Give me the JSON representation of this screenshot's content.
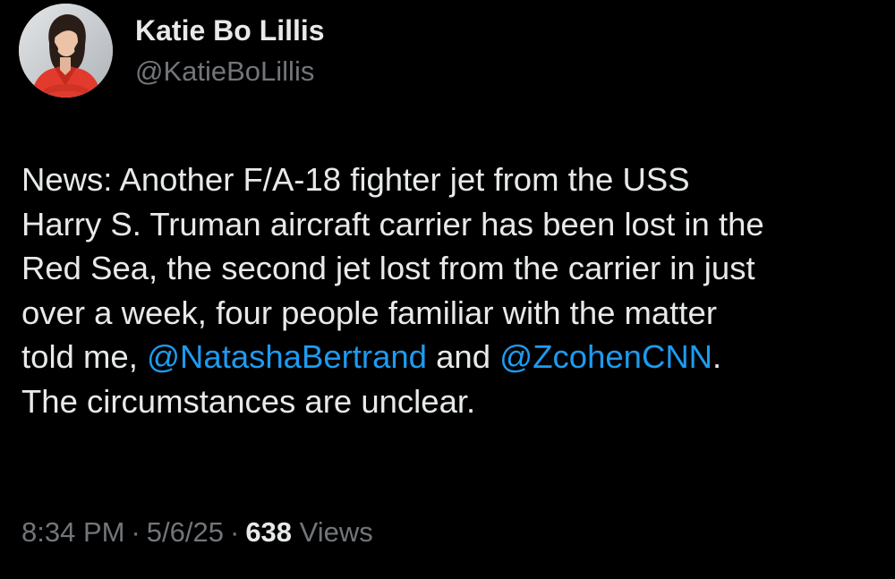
{
  "author": {
    "display_name": "Katie Bo Lillis",
    "handle": "@KatieBoLillis"
  },
  "tweet": {
    "lines": [
      [
        {
          "text": "News: Another F/A-18 fighter jet from the USS",
          "type": "text"
        }
      ],
      [
        {
          "text": "Harry S. Truman aircraft carrier has been lost in the",
          "type": "text"
        }
      ],
      [
        {
          "text": "Red Sea, the second jet lost from the carrier in just",
          "type": "text"
        }
      ],
      [
        {
          "text": "over a week, four people familiar with the matter",
          "type": "text"
        }
      ],
      [
        {
          "text": "told me, ",
          "type": "text"
        },
        {
          "text": "@NatashaBertrand",
          "type": "mention"
        },
        {
          "text": " and ",
          "type": "text"
        },
        {
          "text": "@ZcohenCNN",
          "type": "mention"
        },
        {
          "text": ".",
          "type": "text"
        }
      ],
      [
        {
          "text": "The circumstances are unclear.",
          "type": "text"
        }
      ]
    ]
  },
  "meta": {
    "time": "8:34 PM",
    "separator": "·",
    "date": "5/6/25",
    "views_count": "638",
    "views_label": "Views"
  },
  "colors": {
    "background": "#000000",
    "primary_text": "#e7e9ea",
    "secondary_text": "#71767b",
    "mention": "#1d9bf0"
  }
}
